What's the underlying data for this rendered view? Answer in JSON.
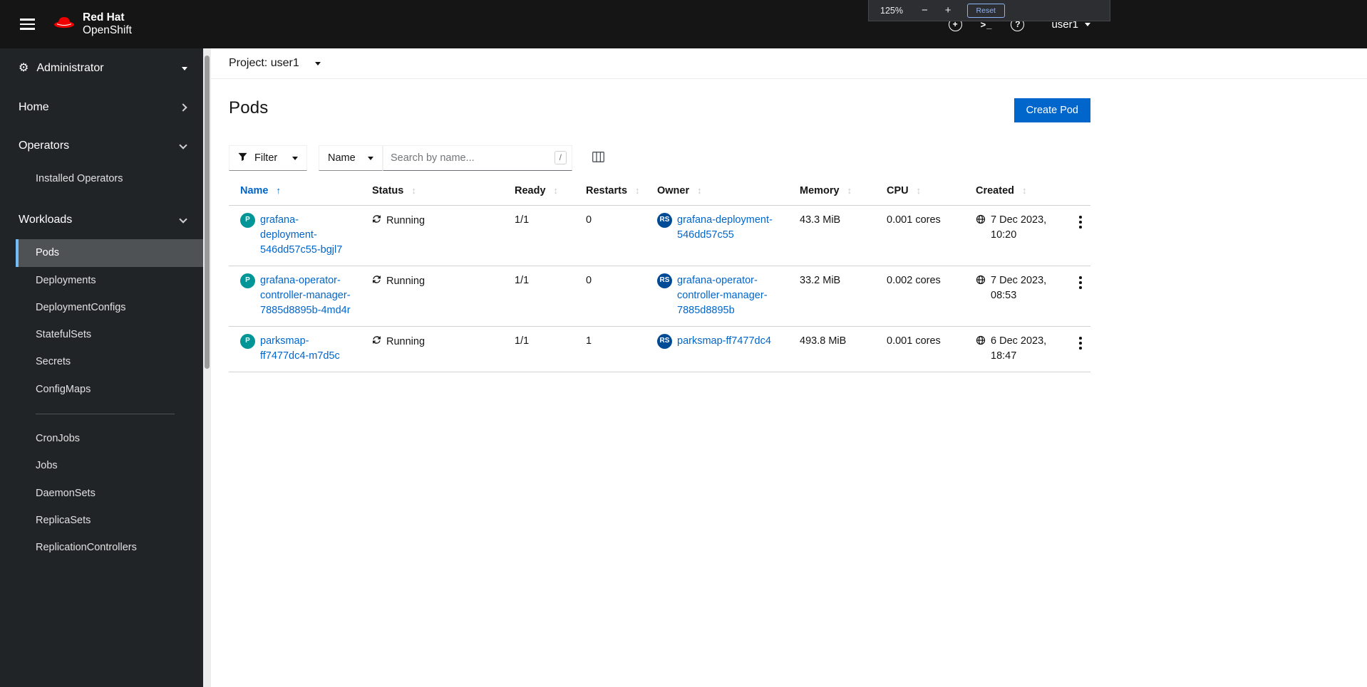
{
  "masthead": {
    "brand_line1": "Red Hat",
    "brand_line2": "OpenShift",
    "zoom_popup": {
      "level": "125%",
      "minus": "−",
      "plus": "+",
      "reset_label": "Reset"
    },
    "icons": {
      "plus": "+",
      "terminal": ">_",
      "help": "?"
    },
    "user": "user1"
  },
  "sidebar": {
    "perspective": "Administrator",
    "groups": [
      {
        "label": "Home",
        "expanded": false,
        "items": []
      },
      {
        "label": "Operators",
        "expanded": true,
        "items": [
          {
            "label": "Installed Operators"
          }
        ]
      },
      {
        "label": "Workloads",
        "expanded": true,
        "items": [
          {
            "label": "Pods",
            "active": true
          },
          {
            "label": "Deployments"
          },
          {
            "label": "DeploymentConfigs"
          },
          {
            "label": "StatefulSets"
          },
          {
            "label": "Secrets"
          },
          {
            "label": "ConfigMaps"
          },
          {
            "divider": true
          },
          {
            "label": "CronJobs"
          },
          {
            "label": "Jobs"
          },
          {
            "label": "DaemonSets"
          },
          {
            "label": "ReplicaSets"
          },
          {
            "label": "ReplicationControllers"
          }
        ]
      }
    ]
  },
  "project_bar": {
    "label": "Project: user1"
  },
  "page": {
    "title": "Pods",
    "create_button": "Create Pod"
  },
  "toolbar": {
    "filter_label": "Filter",
    "attribute_label": "Name",
    "search_placeholder": "Search by name...",
    "shortcut_hint": "/"
  },
  "table": {
    "columns": [
      {
        "label": "Name",
        "sorted": "asc"
      },
      {
        "label": "Status"
      },
      {
        "label": "Ready"
      },
      {
        "label": "Restarts"
      },
      {
        "label": "Owner"
      },
      {
        "label": "Memory"
      },
      {
        "label": "CPU"
      },
      {
        "label": "Created"
      }
    ],
    "badges": {
      "pod": "P",
      "replicaset": "RS"
    },
    "rows": [
      {
        "name": "grafana-deployment-546dd57c55-bgjl7",
        "status": "Running",
        "ready": "1/1",
        "restarts": "0",
        "owner": "grafana-deployment-546dd57c55",
        "memory": "43.3 MiB",
        "cpu": "0.001 cores",
        "created": "7 Dec 2023, 10:20"
      },
      {
        "name": "grafana-operator-controller-manager-7885d8895b-4md4r",
        "status": "Running",
        "ready": "1/1",
        "restarts": "0",
        "owner": "grafana-operator-controller-manager-7885d8895b",
        "memory": "33.2 MiB",
        "cpu": "0.002 cores",
        "created": "7 Dec 2023, 08:53"
      },
      {
        "name": "parksmap-ff7477dc4-m7d5c",
        "status": "Running",
        "ready": "1/1",
        "restarts": "1",
        "owner": "parksmap-ff7477dc4",
        "memory": "493.8 MiB",
        "cpu": "0.001 cores",
        "created": "6 Dec 2023, 18:47"
      }
    ]
  },
  "colors": {
    "accent": "#0066cc",
    "pod_badge": "#009596",
    "replicaset_badge": "#004b95",
    "masthead_bg": "#151515",
    "sidebar_bg": "#212427",
    "nav_active_bg": "#4f5255",
    "nav_active_border": "#73bcf7"
  }
}
